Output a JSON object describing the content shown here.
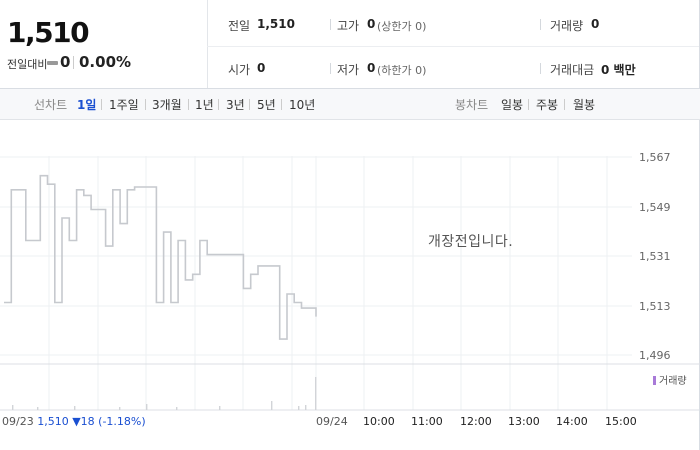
{
  "quote": {
    "price": "1,510",
    "change_label": "전일대비",
    "change_value": "0",
    "change_pct": "0.00%"
  },
  "stats": [
    {
      "label": "전일",
      "value": "1,510",
      "sub": ""
    },
    {
      "label": "고가",
      "value": "0",
      "sub": "(상한가 0)"
    },
    {
      "label": "거래량",
      "value": "0",
      "sub": ""
    },
    {
      "label": "시가",
      "value": "0",
      "sub": ""
    },
    {
      "label": "저가",
      "value": "0",
      "sub": "(하한가 0)"
    },
    {
      "label": "거래대금",
      "value": "0 백만",
      "sub": ""
    }
  ],
  "line_tabs": {
    "label": "선차트",
    "items": [
      "1일",
      "1주일",
      "3개월",
      "1년",
      "3년",
      "5년",
      "10년"
    ],
    "active": "1일"
  },
  "candle_tabs": {
    "label": "봉차트",
    "items": [
      "일봉",
      "주봉",
      "월봉"
    ]
  },
  "chart": {
    "notice": "개장전입니다.",
    "volume_legend": "거래량",
    "footer_date": "09/23",
    "footer_price": "1,510",
    "footer_change": "▼18",
    "footer_pct": "(-1.18%)"
  },
  "chart_data": {
    "type": "line",
    "y_ticks": [
      "1,567",
      "1,549",
      "1,531",
      "1,513",
      "1,496"
    ],
    "ylim": [
      1496,
      1567
    ],
    "x_tick_labels": [
      "09/24",
      "10:00",
      "11:00",
      "12:00",
      "13:00",
      "14:00",
      "15:00"
    ],
    "series": [
      {
        "values": [
          1515,
          1555,
          1555,
          1537,
          1537,
          1560,
          1557,
          1515,
          1545,
          1537,
          1555,
          1553,
          1548,
          1548,
          1535,
          1555,
          1543,
          1555,
          1556,
          1556,
          1556,
          1515,
          1540,
          1515,
          1537,
          1523,
          1525,
          1537,
          1532,
          1532,
          1532,
          1532,
          1532,
          1520,
          1525,
          1528,
          1528,
          1528,
          1502,
          1518,
          1515,
          1513,
          1513,
          1510
        ]
      }
    ],
    "grid": true
  }
}
